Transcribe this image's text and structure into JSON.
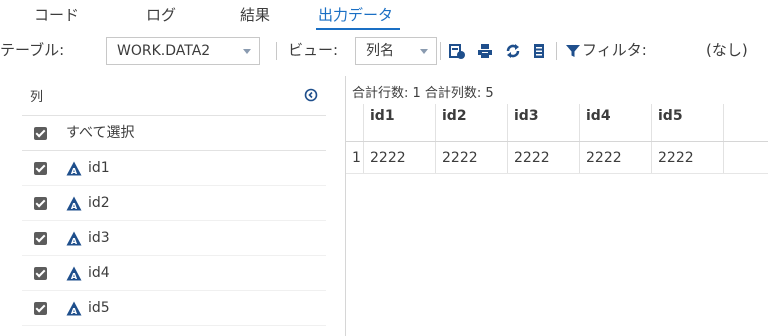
{
  "tabs": [
    {
      "label": "コード"
    },
    {
      "label": "ログ"
    },
    {
      "label": "結果"
    },
    {
      "label": "出力データ",
      "active": true
    }
  ],
  "toolbar": {
    "table_label": "テーブル:",
    "table_value": "WORK.DATA2",
    "view_label": "ビュー:",
    "view_value": "列名",
    "filter_label": "フィルタ:",
    "filter_value": "(なし)",
    "icons": [
      "properties-icon",
      "print-icon",
      "refresh-icon",
      "list-icon",
      "filter-icon"
    ]
  },
  "columns_panel": {
    "title": "列",
    "items": [
      {
        "label": "すべて選択",
        "checked": true,
        "select_all": true
      },
      {
        "label": "id1",
        "checked": true,
        "type_icon": "character-type-icon"
      },
      {
        "label": "id2",
        "checked": true,
        "type_icon": "character-type-icon"
      },
      {
        "label": "id3",
        "checked": true,
        "type_icon": "character-type-icon"
      },
      {
        "label": "id4",
        "checked": true,
        "type_icon": "character-type-icon"
      },
      {
        "label": "id5",
        "checked": true,
        "type_icon": "character-type-icon"
      }
    ]
  },
  "grid": {
    "summary": "合計行数: 1  合計列数: 5",
    "headers": [
      "",
      "id1",
      "id2",
      "id3",
      "id4",
      "id5"
    ],
    "rows": [
      [
        "1",
        "2222",
        "2222",
        "2222",
        "2222",
        "2222"
      ]
    ]
  },
  "colors": {
    "accent": "#1a6fc4",
    "icon_navy": "#1f4f8c"
  }
}
